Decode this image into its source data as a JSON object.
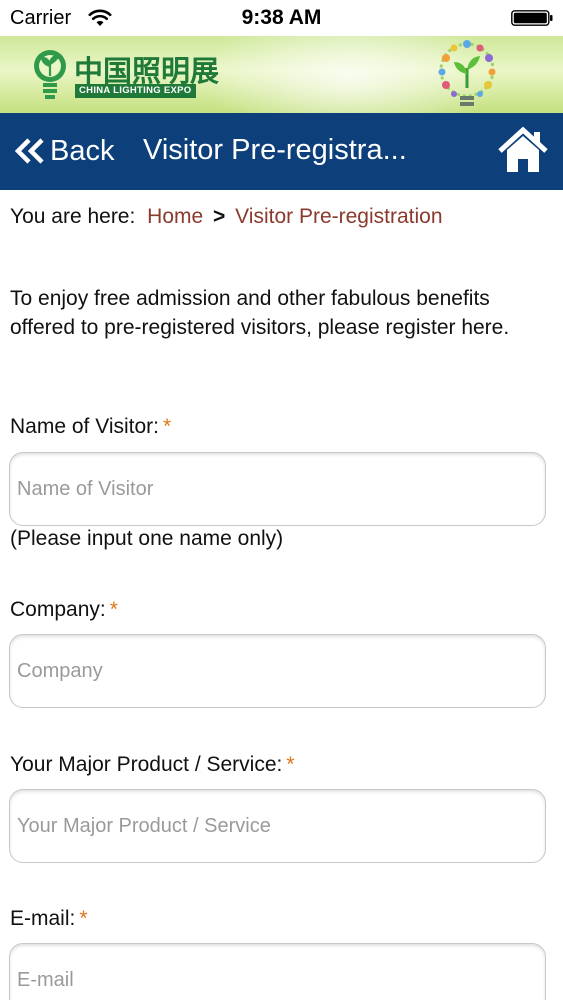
{
  "status_bar": {
    "carrier": "Carrier",
    "time": "9:38 AM"
  },
  "banner": {
    "logo_text_cn": "中国照明展",
    "logo_text_en": "CHINA LIGHTING EXPO",
    "brand_green": "#1f7a3a"
  },
  "navbar": {
    "back_label": "Back",
    "title": "Visitor Pre-registra...",
    "background": "#0d3f7a",
    "icons": [
      "double-chevron-left-icon",
      "home-icon"
    ]
  },
  "breadcrumb": {
    "prefix": "You are here:",
    "home": "Home",
    "separator": ">",
    "current": "Visitor Pre-registration",
    "link_color": "#8a3a2c"
  },
  "intro": "To enjoy free admission and other fabulous benefits offered to pre-registered visitors, please register here.",
  "form": {
    "required_mark": "*",
    "required_color": "#e0751a",
    "fields": [
      {
        "label": "Name of Visitor:",
        "placeholder": "Name of Visitor",
        "value": "",
        "hint": "(Please input one name only)"
      },
      {
        "label": "Company:",
        "placeholder": "Company",
        "value": ""
      },
      {
        "label": "Your Major Product / Service:",
        "placeholder": "Your Major Product / Service",
        "value": ""
      },
      {
        "label": "E-mail:",
        "placeholder": "E-mail",
        "value": ""
      }
    ]
  }
}
